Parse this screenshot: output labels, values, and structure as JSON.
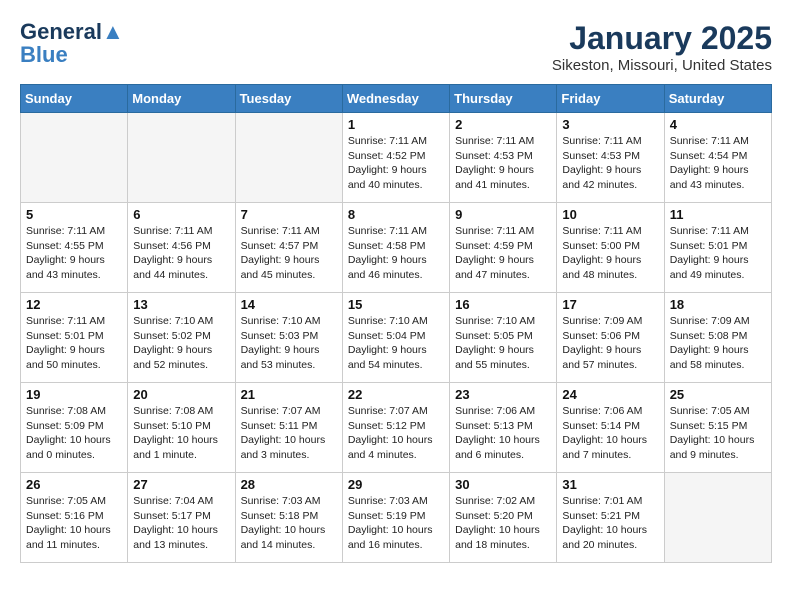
{
  "header": {
    "logo_line1": "General",
    "logo_line2": "Blue",
    "month": "January 2025",
    "location": "Sikeston, Missouri, United States"
  },
  "days_of_week": [
    "Sunday",
    "Monday",
    "Tuesday",
    "Wednesday",
    "Thursday",
    "Friday",
    "Saturday"
  ],
  "weeks": [
    [
      {
        "day": "",
        "info": ""
      },
      {
        "day": "",
        "info": ""
      },
      {
        "day": "",
        "info": ""
      },
      {
        "day": "1",
        "info": "Sunrise: 7:11 AM\nSunset: 4:52 PM\nDaylight: 9 hours and 40 minutes."
      },
      {
        "day": "2",
        "info": "Sunrise: 7:11 AM\nSunset: 4:53 PM\nDaylight: 9 hours and 41 minutes."
      },
      {
        "day": "3",
        "info": "Sunrise: 7:11 AM\nSunset: 4:53 PM\nDaylight: 9 hours and 42 minutes."
      },
      {
        "day": "4",
        "info": "Sunrise: 7:11 AM\nSunset: 4:54 PM\nDaylight: 9 hours and 43 minutes."
      }
    ],
    [
      {
        "day": "5",
        "info": "Sunrise: 7:11 AM\nSunset: 4:55 PM\nDaylight: 9 hours and 43 minutes."
      },
      {
        "day": "6",
        "info": "Sunrise: 7:11 AM\nSunset: 4:56 PM\nDaylight: 9 hours and 44 minutes."
      },
      {
        "day": "7",
        "info": "Sunrise: 7:11 AM\nSunset: 4:57 PM\nDaylight: 9 hours and 45 minutes."
      },
      {
        "day": "8",
        "info": "Sunrise: 7:11 AM\nSunset: 4:58 PM\nDaylight: 9 hours and 46 minutes."
      },
      {
        "day": "9",
        "info": "Sunrise: 7:11 AM\nSunset: 4:59 PM\nDaylight: 9 hours and 47 minutes."
      },
      {
        "day": "10",
        "info": "Sunrise: 7:11 AM\nSunset: 5:00 PM\nDaylight: 9 hours and 48 minutes."
      },
      {
        "day": "11",
        "info": "Sunrise: 7:11 AM\nSunset: 5:01 PM\nDaylight: 9 hours and 49 minutes."
      }
    ],
    [
      {
        "day": "12",
        "info": "Sunrise: 7:11 AM\nSunset: 5:01 PM\nDaylight: 9 hours and 50 minutes."
      },
      {
        "day": "13",
        "info": "Sunrise: 7:10 AM\nSunset: 5:02 PM\nDaylight: 9 hours and 52 minutes."
      },
      {
        "day": "14",
        "info": "Sunrise: 7:10 AM\nSunset: 5:03 PM\nDaylight: 9 hours and 53 minutes."
      },
      {
        "day": "15",
        "info": "Sunrise: 7:10 AM\nSunset: 5:04 PM\nDaylight: 9 hours and 54 minutes."
      },
      {
        "day": "16",
        "info": "Sunrise: 7:10 AM\nSunset: 5:05 PM\nDaylight: 9 hours and 55 minutes."
      },
      {
        "day": "17",
        "info": "Sunrise: 7:09 AM\nSunset: 5:06 PM\nDaylight: 9 hours and 57 minutes."
      },
      {
        "day": "18",
        "info": "Sunrise: 7:09 AM\nSunset: 5:08 PM\nDaylight: 9 hours and 58 minutes."
      }
    ],
    [
      {
        "day": "19",
        "info": "Sunrise: 7:08 AM\nSunset: 5:09 PM\nDaylight: 10 hours and 0 minutes."
      },
      {
        "day": "20",
        "info": "Sunrise: 7:08 AM\nSunset: 5:10 PM\nDaylight: 10 hours and 1 minute."
      },
      {
        "day": "21",
        "info": "Sunrise: 7:07 AM\nSunset: 5:11 PM\nDaylight: 10 hours and 3 minutes."
      },
      {
        "day": "22",
        "info": "Sunrise: 7:07 AM\nSunset: 5:12 PM\nDaylight: 10 hours and 4 minutes."
      },
      {
        "day": "23",
        "info": "Sunrise: 7:06 AM\nSunset: 5:13 PM\nDaylight: 10 hours and 6 minutes."
      },
      {
        "day": "24",
        "info": "Sunrise: 7:06 AM\nSunset: 5:14 PM\nDaylight: 10 hours and 7 minutes."
      },
      {
        "day": "25",
        "info": "Sunrise: 7:05 AM\nSunset: 5:15 PM\nDaylight: 10 hours and 9 minutes."
      }
    ],
    [
      {
        "day": "26",
        "info": "Sunrise: 7:05 AM\nSunset: 5:16 PM\nDaylight: 10 hours and 11 minutes."
      },
      {
        "day": "27",
        "info": "Sunrise: 7:04 AM\nSunset: 5:17 PM\nDaylight: 10 hours and 13 minutes."
      },
      {
        "day": "28",
        "info": "Sunrise: 7:03 AM\nSunset: 5:18 PM\nDaylight: 10 hours and 14 minutes."
      },
      {
        "day": "29",
        "info": "Sunrise: 7:03 AM\nSunset: 5:19 PM\nDaylight: 10 hours and 16 minutes."
      },
      {
        "day": "30",
        "info": "Sunrise: 7:02 AM\nSunset: 5:20 PM\nDaylight: 10 hours and 18 minutes."
      },
      {
        "day": "31",
        "info": "Sunrise: 7:01 AM\nSunset: 5:21 PM\nDaylight: 10 hours and 20 minutes."
      },
      {
        "day": "",
        "info": ""
      }
    ]
  ]
}
